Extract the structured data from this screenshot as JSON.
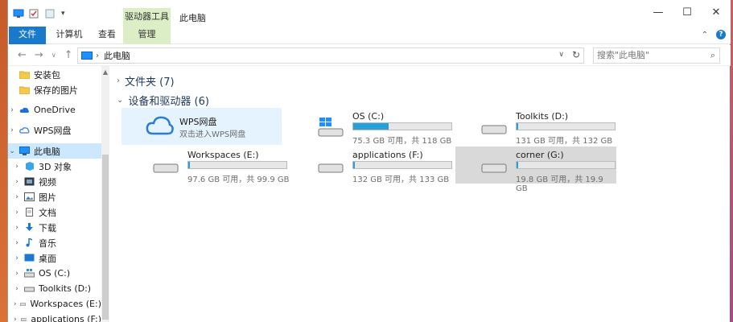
{
  "titlebar": {
    "context_tab": "驱动器工具",
    "title": "此电脑",
    "minimize": "—",
    "maximize": "☐",
    "close": "✕"
  },
  "ribbon": {
    "tabs": [
      "文件",
      "计算机",
      "查看",
      "管理"
    ],
    "collapse": "⌃",
    "help": "?"
  },
  "address": {
    "path": "此电脑",
    "search_placeholder": "搜索\"此电脑\""
  },
  "sidebar": {
    "items": [
      {
        "label": "安装包",
        "icon": "folder-icon"
      },
      {
        "label": "保存的图片",
        "icon": "folder-icon"
      },
      {
        "label": "OneDrive",
        "icon": "cloud-icon"
      },
      {
        "label": "WPS网盘",
        "icon": "cloud-icon"
      },
      {
        "label": "此电脑",
        "icon": "computer-icon"
      },
      {
        "label": "3D 对象",
        "icon": "cube-icon"
      },
      {
        "label": "视频",
        "icon": "video-icon"
      },
      {
        "label": "图片",
        "icon": "image-icon"
      },
      {
        "label": "文档",
        "icon": "document-icon"
      },
      {
        "label": "下载",
        "icon": "download-icon"
      },
      {
        "label": "音乐",
        "icon": "music-icon"
      },
      {
        "label": "桌面",
        "icon": "desktop-icon"
      },
      {
        "label": "OS (C:)",
        "icon": "windows-drive-icon"
      },
      {
        "label": "Toolkits (D:)",
        "icon": "drive-icon"
      },
      {
        "label": "Workspaces (E:)",
        "icon": "drive-icon"
      },
      {
        "label": "applications (F:)",
        "icon": "drive-icon"
      }
    ]
  },
  "content": {
    "folders_group": "文件夹 (7)",
    "drives_group": "设备和驱动器 (6)",
    "wps": {
      "name": "WPS网盘",
      "desc": "双击进入WPS网盘"
    },
    "drives": [
      {
        "name": "OS (C:)",
        "free": "75.3 GB 可用，共 118 GB",
        "used_fraction": 0.36,
        "icon": "windows-drive-icon"
      },
      {
        "name": "Toolkits (D:)",
        "free": "131 GB 可用，共 132 GB",
        "used_fraction": 0.01,
        "icon": "drive-icon"
      },
      {
        "name": "Workspaces (E:)",
        "free": "97.6 GB 可用，共 99.9 GB",
        "used_fraction": 0.02,
        "icon": "drive-icon"
      },
      {
        "name": "applications (F:)",
        "free": "132 GB 可用，共 133 GB",
        "used_fraction": 0.01,
        "icon": "drive-icon"
      },
      {
        "name": "corner (G:)",
        "free": "19.8 GB 可用，共 19.9 GB",
        "used_fraction": 0.01,
        "icon": "drive-icon"
      }
    ]
  },
  "colors": {
    "accent": "#1979ca",
    "context_tab": "#dbeec6",
    "bar_fill": "#26a0da",
    "selection": "#cce8ff"
  }
}
